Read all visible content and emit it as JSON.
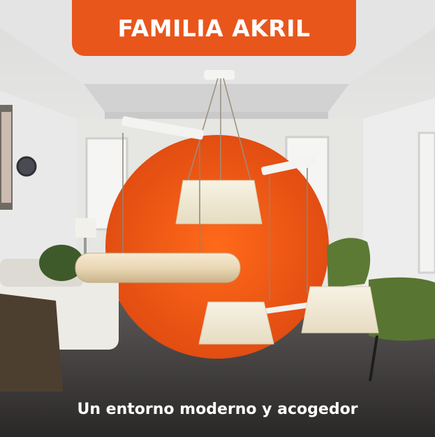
{
  "banner": {
    "title": "FAMILIA AKRIL"
  },
  "caption": {
    "text": "Un entorno moderno y acogedor"
  },
  "colors": {
    "accent": "#e8561c",
    "text": "#ffffff"
  }
}
